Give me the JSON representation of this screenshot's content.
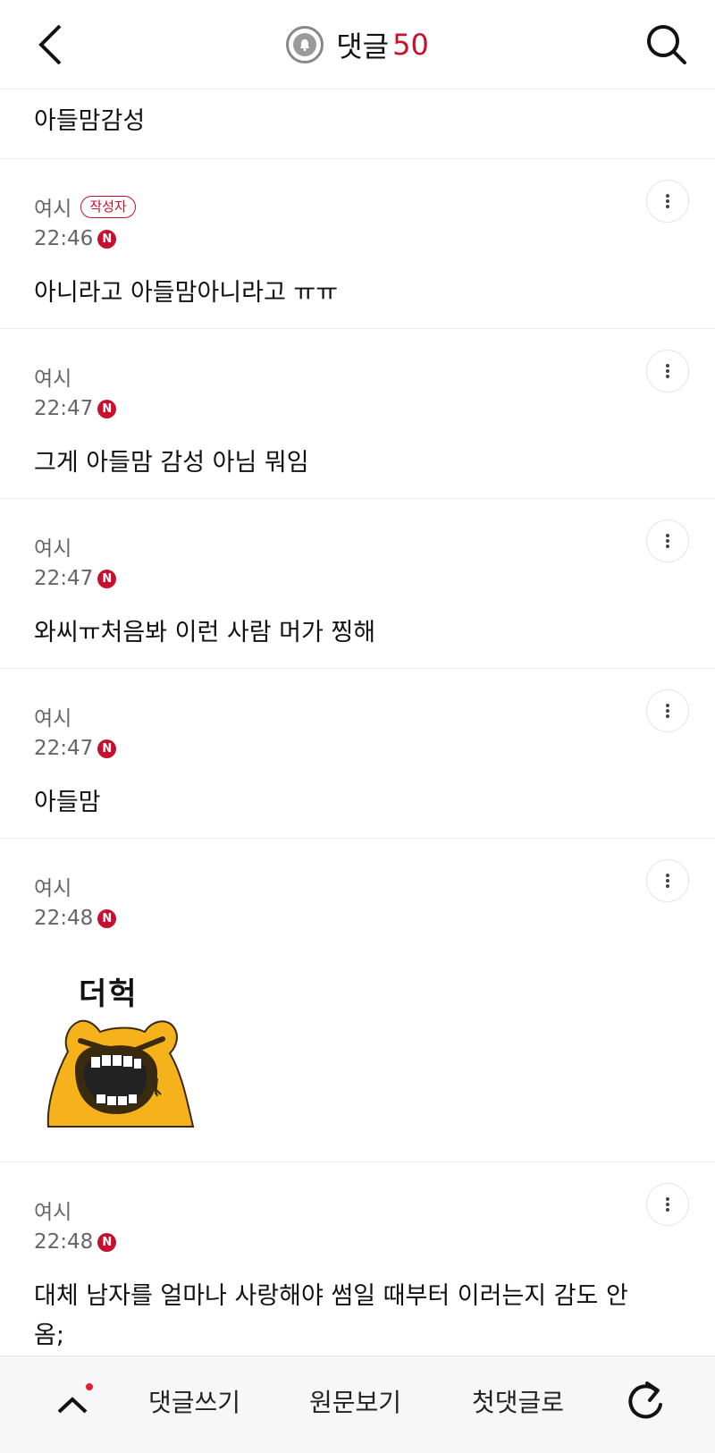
{
  "header": {
    "title": "댓글",
    "count": "50",
    "back_icon": "chevron-left-icon",
    "bell_icon": "bell-icon",
    "search_icon": "search-icon"
  },
  "first_item": {
    "text": "아들맘감성"
  },
  "comments": [
    {
      "author": "여시",
      "badge": "작성자",
      "time": "22:46",
      "new": "N",
      "text": "아니라고 아들맘아니라고 ㅠㅠ"
    },
    {
      "author": "여시",
      "time": "22:47",
      "new": "N",
      "text": "그게 아들맘 감성 아님 뭐임"
    },
    {
      "author": "여시",
      "time": "22:47",
      "new": "N",
      "text": "와씨ㅠ처음봐 이런 사람 머가 찡해"
    },
    {
      "author": "여시",
      "time": "22:47",
      "new": "N",
      "text": "아들맘"
    },
    {
      "author": "여시",
      "time": "22:48",
      "new": "N",
      "sticker_text": "더헉"
    },
    {
      "author": "여시",
      "time": "22:48",
      "new": "N",
      "text": "대체 남자를 얼마나 사랑해야 썸일 때부터 이러는지 감도 안 옴;"
    }
  ],
  "bottom_bar": {
    "write": "댓글쓰기",
    "original": "원문보기",
    "first_comment": "첫댓글로",
    "up_icon": "chevron-up-icon",
    "refresh_icon": "refresh-icon"
  },
  "colors": {
    "accent": "#c8102e",
    "text": "#111111",
    "muted": "#666666"
  }
}
